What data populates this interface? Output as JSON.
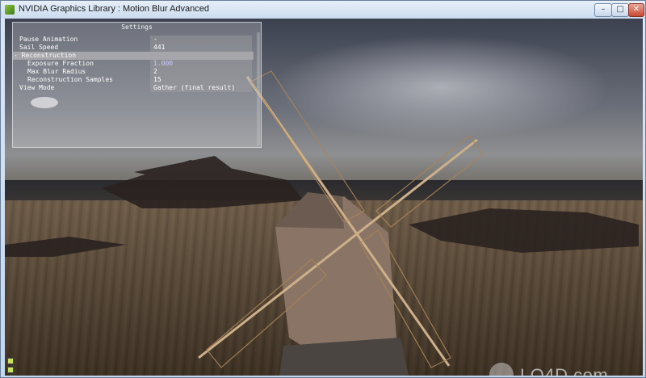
{
  "window": {
    "title": "NVIDIA Graphics Library : Motion Blur Advanced",
    "buttons": {
      "minimize": "–",
      "maximize": "□",
      "close": "✕"
    }
  },
  "settings": {
    "title": "Settings",
    "rows": [
      {
        "key": "Pause Animation",
        "value": "-"
      },
      {
        "key": "Sail Speed",
        "value": "441"
      },
      {
        "key": "- Reconstruction",
        "value": ""
      },
      {
        "key": "Exposure Fraction",
        "value": "1.000"
      },
      {
        "key": "Max Blur Radius",
        "value": "2"
      },
      {
        "key": "Reconstruction Samples",
        "value": "15"
      },
      {
        "key": "View Mode",
        "value": "Gather (final result)"
      }
    ]
  },
  "watermark": {
    "text": "LO4D.com"
  },
  "colors": {
    "title_bar": "#cbdcef",
    "close_button": "#c84a33",
    "value_highlight": "#c8e05a"
  }
}
